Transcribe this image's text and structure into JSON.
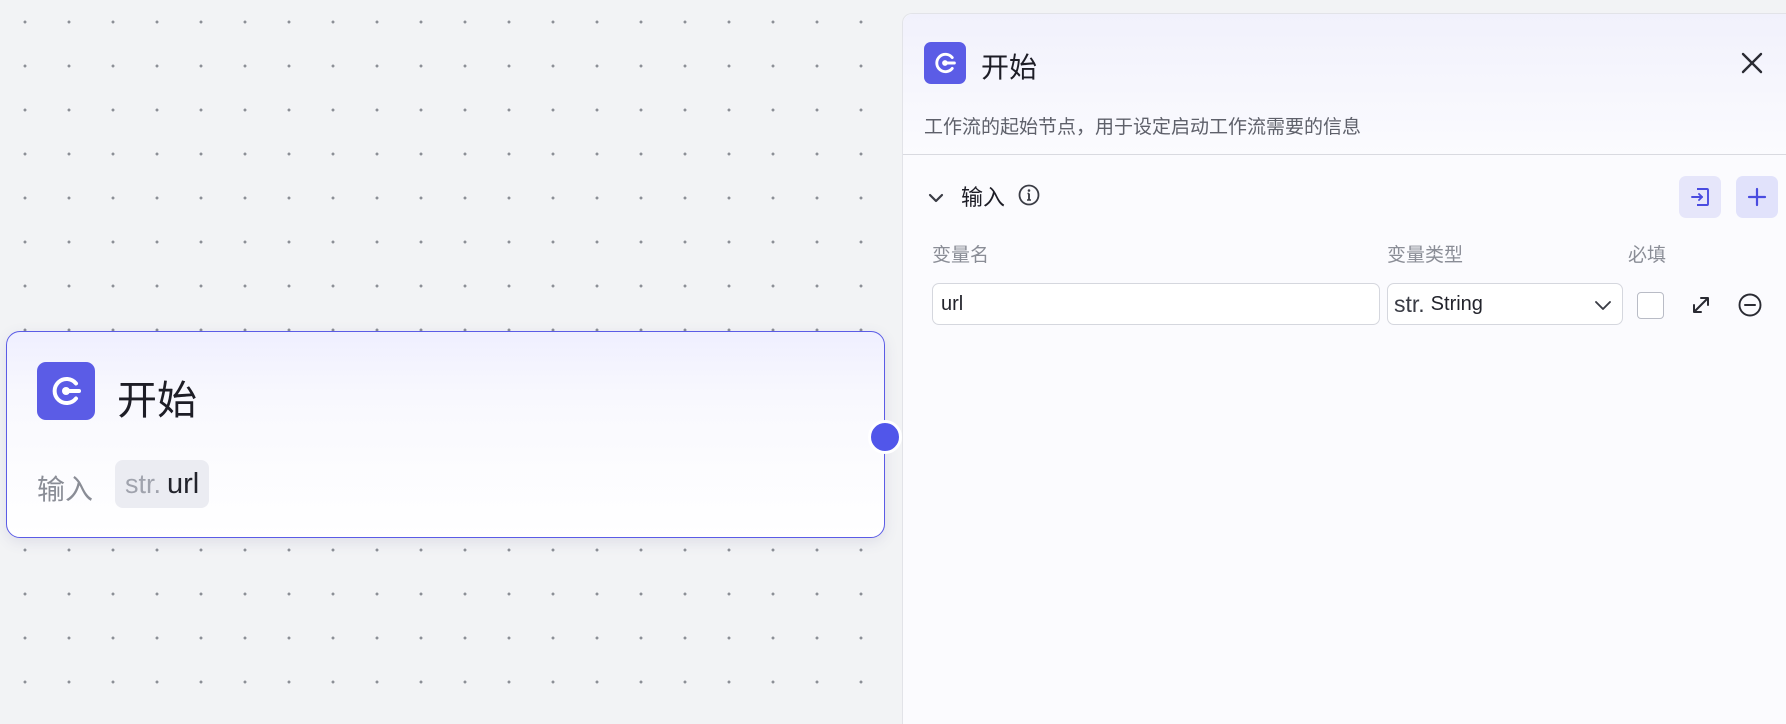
{
  "node": {
    "title": "开始",
    "input_label": "输入",
    "variable": {
      "type_abbr": "str.",
      "name": "url"
    }
  },
  "panel": {
    "title": "开始",
    "description": "工作流的起始节点，用于设定启动工作流需要的信息",
    "section": {
      "title": "输入",
      "columns": {
        "name": "变量名",
        "type": "变量类型",
        "required": "必填"
      },
      "rows": [
        {
          "name": "url",
          "type_prefix": "str.",
          "type": "String",
          "required": false
        }
      ]
    }
  },
  "colors": {
    "accent": "#5b5ce6",
    "handle": "#5156ea",
    "canvas_bg": "#f2f3f5"
  },
  "icons": {
    "node_icon": "start-node-icon",
    "close": "close-icon",
    "collapse": "chevron-down-icon",
    "info": "info-icon",
    "import": "import-icon",
    "add": "plus-icon",
    "expand": "expand-icon",
    "remove": "minus-circle-icon"
  }
}
